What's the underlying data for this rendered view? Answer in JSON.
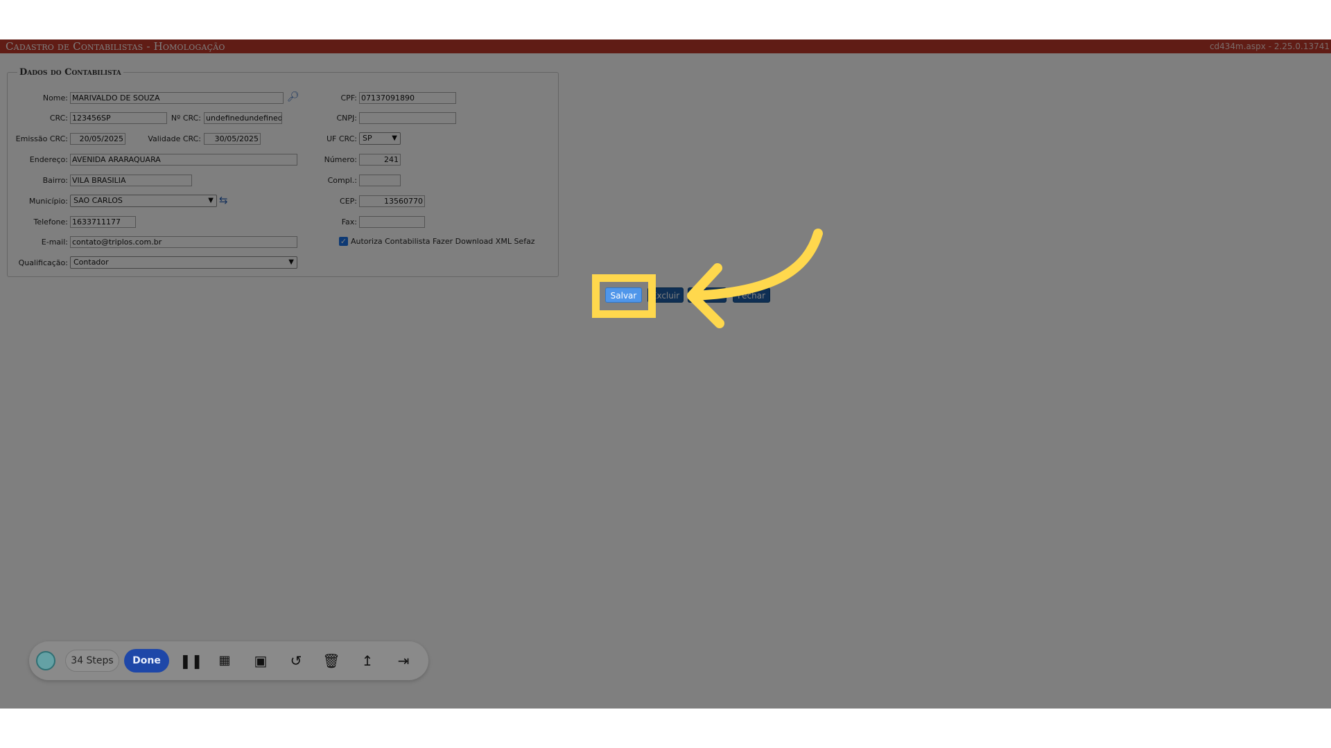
{
  "header": {
    "title": "Cadastro de Contabilistas  - Homologação",
    "version": "cd434m.aspx - 2.25.0.13741"
  },
  "form": {
    "legend": "Dados do Contabilista",
    "nome": {
      "label": "Nome:",
      "value": "MARIVALDO DE SOUZA"
    },
    "cpf": {
      "label": "CPF:",
      "value": "07137091890"
    },
    "crc": {
      "label": "CRC:",
      "value": "123456SP"
    },
    "nr_crc": {
      "label": "Nº CRC:",
      "value": "undefinedundefined"
    },
    "cnpj": {
      "label": "CNPJ:",
      "value": ""
    },
    "emissao_crc": {
      "label": "Emissão CRC:",
      "value": "20/05/2025"
    },
    "validade_crc": {
      "label": "Validade CRC:",
      "value": "30/05/2025"
    },
    "uf_crc": {
      "label": "UF CRC:",
      "value": "SP"
    },
    "endereco": {
      "label": "Endereço:",
      "value": "AVENIDA ARARAQUARA"
    },
    "numero": {
      "label": "Número:",
      "value": "241"
    },
    "bairro": {
      "label": "Bairro:",
      "value": "VILA BRASILIA"
    },
    "compl": {
      "label": "Compl.:",
      "value": ""
    },
    "municipio": {
      "label": "Município:",
      "value": "SAO CARLOS"
    },
    "cep": {
      "label": "CEP:",
      "value": "13560770"
    },
    "telefone": {
      "label": "Telefone:",
      "value": "1633711177"
    },
    "fax": {
      "label": "Fax:",
      "value": ""
    },
    "email": {
      "label": "E-mail:",
      "value": "contato@triplos.com.br"
    },
    "autoriza": {
      "label": "Autoriza Contabilista Fazer Download XML Sefaz",
      "checked": true
    },
    "qualificacao": {
      "label": "Qualificação:",
      "value": "Contador"
    }
  },
  "actions": {
    "salvar": "Salvar",
    "excluir": "Excluir",
    "fechar": "Fechar"
  },
  "recorder": {
    "steps": "34 Steps",
    "done": "Done"
  },
  "colors": {
    "highlight": "#ffd84d",
    "titlebar": "#c0392b",
    "done_button": "#1e47a8"
  }
}
